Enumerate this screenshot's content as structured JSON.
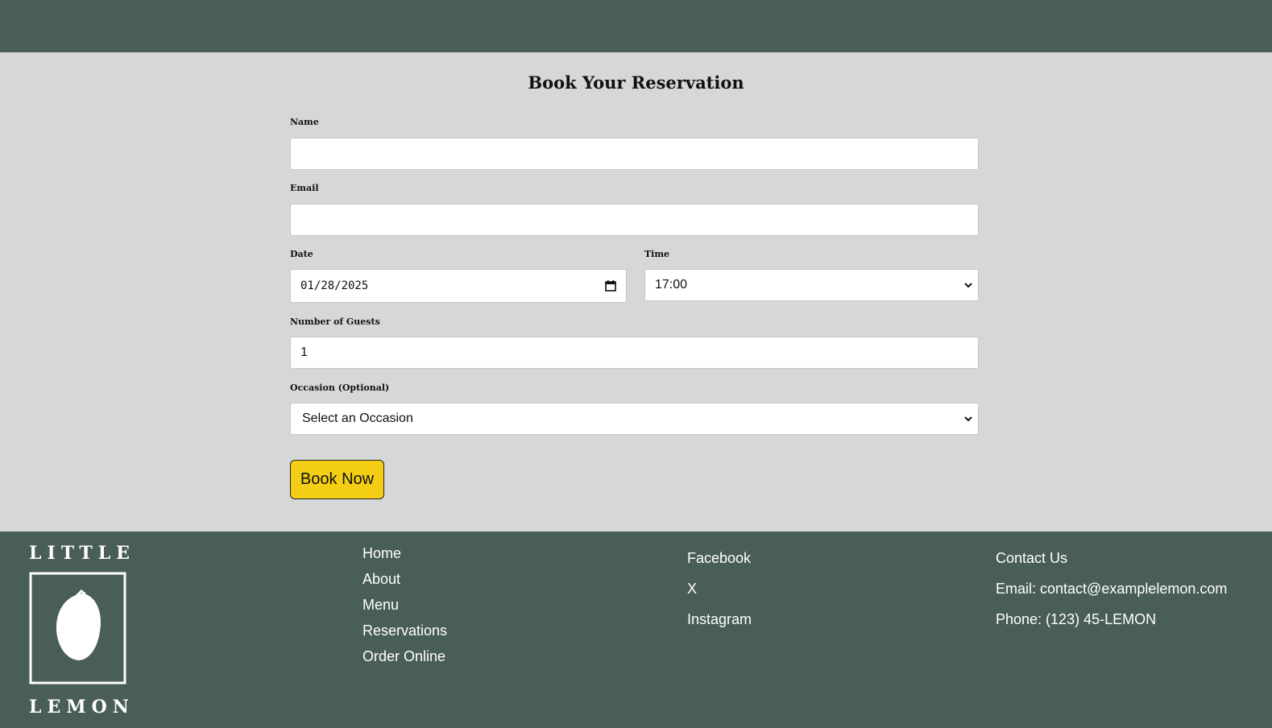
{
  "form": {
    "title": "Book Your Reservation",
    "name_label": "Name",
    "name_value": "",
    "email_label": "Email",
    "email_value": "",
    "date_label": "Date",
    "date_value": "01/28/2025",
    "time_label": "Time",
    "time_value": "17:00",
    "guests_label": "Number of Guests",
    "guests_value": "1",
    "occasion_label": "Occasion (Optional)",
    "occasion_value": "Select an Occasion",
    "submit_label": "Book Now"
  },
  "footer": {
    "logo_top": "LITTLE",
    "logo_bottom": "LEMON",
    "nav": [
      "Home",
      "About",
      "Menu",
      "Reservations",
      "Order Online"
    ],
    "social": [
      "Facebook",
      "X",
      "Instagram"
    ],
    "contact": {
      "heading": "Contact Us",
      "email": "Email: contact@examplelemon.com",
      "phone": "Phone: (123) 45-LEMON"
    }
  },
  "colors": {
    "header_bg": "#495e57",
    "page_bg": "#d6d8d7",
    "button_bg": "#f4ce14"
  }
}
